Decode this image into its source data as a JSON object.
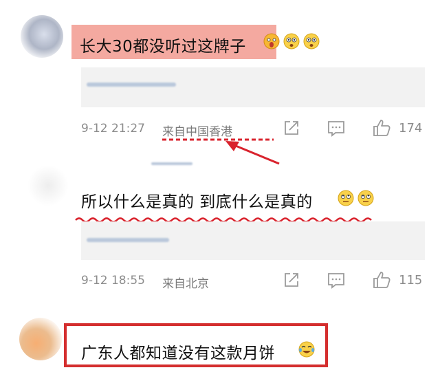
{
  "comments": [
    {
      "text": "长大30都没听过这牌子",
      "time": "9-12 21:27",
      "location": "来自中国香港",
      "likes": "174",
      "highlight_color": "#f4a9a0",
      "emojis": [
        "shocked-face",
        "flushed-face",
        "flushed-face"
      ]
    },
    {
      "text": "所以什么是真的 到底什么是真的",
      "time": "9-12 18:55",
      "location": "来自北京",
      "likes": "115",
      "emojis": [
        "eye-roll-face",
        "eye-roll-face"
      ]
    },
    {
      "text": "广东人都知道没有这款月饼",
      "emojis": [
        "tears-of-joy-face"
      ],
      "box_color": "#d42e2e"
    }
  ],
  "annotation_color": "#d9232d"
}
